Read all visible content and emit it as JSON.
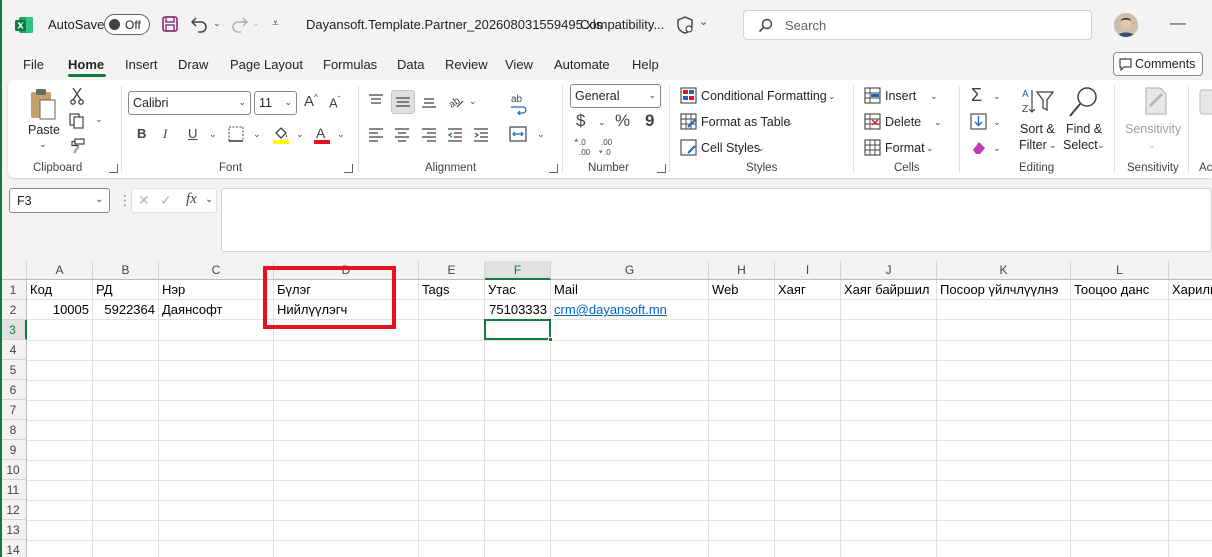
{
  "colors": {
    "excel_green": "#107c41",
    "highlight_red": "#e81123",
    "link_blue": "#0563c1"
  },
  "titlebar": {
    "autosave_label": "AutoSave",
    "autosave_state": "Off",
    "filename": "Dayansoft.Template.Partner_202608031559495.xls",
    "mode": "Compatibility...",
    "search_placeholder": "Search"
  },
  "menu": [
    "File",
    "Home",
    "Insert",
    "Draw",
    "Page Layout",
    "Formulas",
    "Data",
    "Review",
    "View",
    "Automate",
    "Help"
  ],
  "comments_label": "Comments",
  "ribbon": {
    "clipboard": {
      "paste": "Paste",
      "group": "Clipboard"
    },
    "font": {
      "name": "Calibri",
      "size": "11",
      "group": "Font",
      "bold": "B",
      "italic": "I",
      "underline": "U"
    },
    "alignment": {
      "group": "Alignment"
    },
    "number": {
      "format": "General",
      "group": "Number",
      "currency": "$",
      "percent": "%",
      "comma": "9"
    },
    "styles": {
      "conditional": "Conditional Formatting",
      "table": "Format as Table",
      "cell": "Cell Styles",
      "group": "Styles"
    },
    "cells": {
      "insert": "Insert",
      "delete": "Delete",
      "format": "Format",
      "group": "Cells"
    },
    "editing": {
      "sort1": "Sort &",
      "sort2": "Filter",
      "find1": "Find &",
      "find2": "Select",
      "group": "Editing"
    },
    "sensitivity": {
      "label": "Sensitivity",
      "group": "Sensitivity"
    },
    "cut_group": "Ac"
  },
  "formula_bar": {
    "name_box": "F3",
    "formula": ""
  },
  "sheet": {
    "columns": [
      "A",
      "B",
      "C",
      "D",
      "E",
      "F",
      "G",
      "H",
      "I",
      "J",
      "K",
      "L"
    ],
    "rows": [
      "1",
      "2",
      "3",
      "4",
      "5",
      "6",
      "7",
      "8",
      "9",
      "10",
      "11",
      "12",
      "13",
      "14"
    ],
    "headers": [
      "Код",
      "РД",
      "Нэр",
      "Бүлэг",
      "Tags",
      "Утас",
      "Mail",
      "Web",
      "Хаяг",
      "Хаяг байршил",
      "Посоор үйлчлүүлнэ",
      "Тооцоо данс",
      "Харилц"
    ],
    "row2": [
      "10005",
      "5922364",
      "Даянсофт",
      "Нийлүүлэгч",
      "",
      "75103333",
      "crm@dayansoft.mn"
    ]
  }
}
